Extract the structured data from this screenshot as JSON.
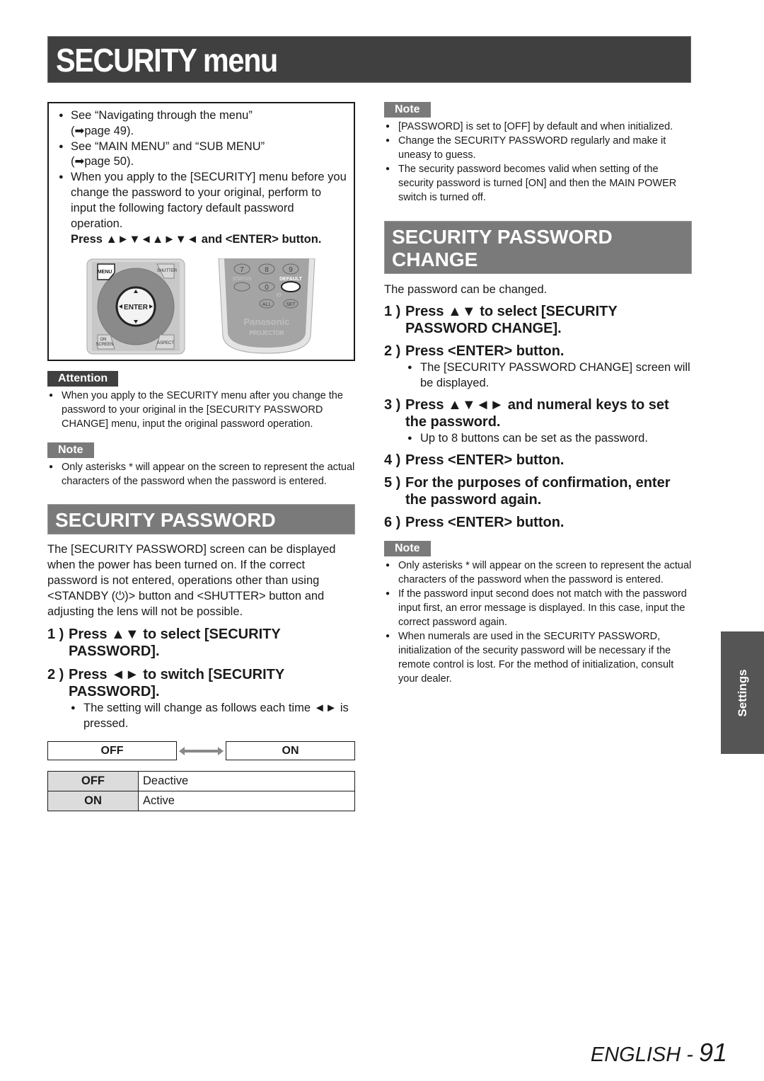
{
  "page_title": "SECURITY menu",
  "intro": {
    "bullets": [
      "See “Navigating through the menu” (➡page 49).",
      "See “MAIN MENU” and “SUB MENU” (➡page 50).",
      "When you apply to the [SECURITY] menu before you change the password to your original, perform to input the following factory default password operation."
    ],
    "bullet_lines": {
      "b0_line1": "See “Navigating through the menu”",
      "b0_line2": "(➡page 49).",
      "b1_line1": "See “MAIN MENU” and “SUB MENU”",
      "b1_line2": "(➡page 50).",
      "b2": "When you apply to the [SECURITY] menu before you change the password to your original, perform to input the following factory default password operation."
    },
    "press_sequence": "Press ▲►▼◄▲►▼◄ and <ENTER> button.",
    "remote_left": {
      "menu": "MENU",
      "shutter": "SHUTTER",
      "enter": "ENTER",
      "on_screen_1": "ON",
      "on_screen_2": "SCREEN",
      "aspect": "ASPECT"
    },
    "remote_right": {
      "keys": [
        "7",
        "8",
        "9",
        "0"
      ],
      "status": "STATUS",
      "default": "DEFAULT",
      "id": "ID",
      "all": "ALL",
      "set": "SET",
      "brand": "Panasonic",
      "product": "PROJECTOR"
    }
  },
  "attention": {
    "label": "Attention",
    "bullets": [
      "When you apply to the SECURITY menu after you change the password to your original in the [SECURITY PASSWORD CHANGE] menu, input the original password operation."
    ]
  },
  "note_left": {
    "label": "Note",
    "bullets": [
      "Only asterisks * will appear on the screen to represent the actual characters of the password when the password is entered."
    ]
  },
  "security_password": {
    "heading": "SECURITY PASSWORD",
    "description": "The [SECURITY PASSWORD] screen can be displayed when the power has been turned on. If the correct password is not entered, operations other than using <STANDBY (⏻)> button and <SHUTTER> button and adjusting the lens will not be possible.",
    "steps": [
      {
        "num": "1 )",
        "text": "Press ▲▼ to select [SECURITY PASSWORD]."
      },
      {
        "num": "2 )",
        "text": "Press ◄► to switch [SECURITY PASSWORD].",
        "sub": "The setting will change as follows each time ◄► is pressed."
      }
    ],
    "toggle": {
      "left": "OFF",
      "right": "ON"
    },
    "options": [
      {
        "key": "OFF",
        "value": "Deactive"
      },
      {
        "key": "ON",
        "value": "Active"
      }
    ]
  },
  "note_right_top": {
    "label": "Note",
    "bullets": [
      "[PASSWORD] is set to [OFF] by default and when initialized.",
      "Change the SECURITY PASSWORD regularly and make it uneasy to guess.",
      "The security password becomes valid when setting of the security password is turned [ON] and then the MAIN POWER switch is turned off."
    ]
  },
  "security_password_change": {
    "heading_line1": "SECURITY PASSWORD",
    "heading_line2": "CHANGE",
    "description": "The password can be changed.",
    "steps": [
      {
        "num": "1 )",
        "text": "Press ▲▼ to select [SECURITY PASSWORD CHANGE]."
      },
      {
        "num": "2 )",
        "text": "Press <ENTER> button.",
        "sub": "The [SECURITY PASSWORD CHANGE] screen will be displayed."
      },
      {
        "num": "3 )",
        "text": "Press ▲▼◄► and numeral keys to set the password.",
        "sub": "Up to 8 buttons can be set as the password."
      },
      {
        "num": "4 )",
        "text": "Press <ENTER> button."
      },
      {
        "num": "5 )",
        "text": "For the purposes of confirmation, enter the password again."
      },
      {
        "num": "6 )",
        "text": "Press <ENTER> button."
      }
    ]
  },
  "note_right_bottom": {
    "label": "Note",
    "bullets": [
      "Only asterisks * will appear on the screen to represent the actual characters of the password when the password is entered.",
      "If the password input second does not match with the password input first, an error message is displayed. In this case, input the correct password again.",
      "When numerals are used in the SECURITY PASSWORD, initialization of the security password will be necessary if the remote control is lost. For the method of initialization, consult your dealer."
    ]
  },
  "side_tab": "Settings",
  "footer": {
    "language": "ENGLISH - ",
    "page_number": "91"
  },
  "colors": {
    "title_bar": "#404040",
    "section_bar": "#7a7a7a",
    "attention_tag": "#404040",
    "note_tag": "#7a7a7a",
    "side_tab": "#555555",
    "table_key_bg": "#dcdcdc"
  }
}
